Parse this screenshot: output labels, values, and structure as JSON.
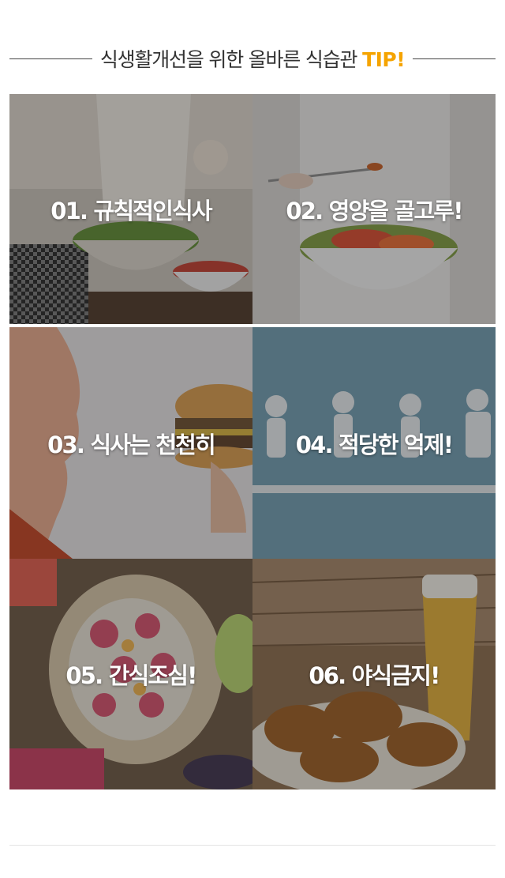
{
  "header": {
    "title": "식생활개선을 위한 올바른 식습관",
    "tip": "TIP!"
  },
  "tips": [
    {
      "label": "01. 규칙적인식사"
    },
    {
      "label": "02. 영양을 골고루!"
    },
    {
      "label": "03. 식사는 천천히"
    },
    {
      "label": "04. 적당한 억제!"
    },
    {
      "label": "05. 간식조심!"
    },
    {
      "label": "06. 야식금지!"
    }
  ],
  "colors": {
    "accent": "#f5a400",
    "title_text": "#333333"
  }
}
